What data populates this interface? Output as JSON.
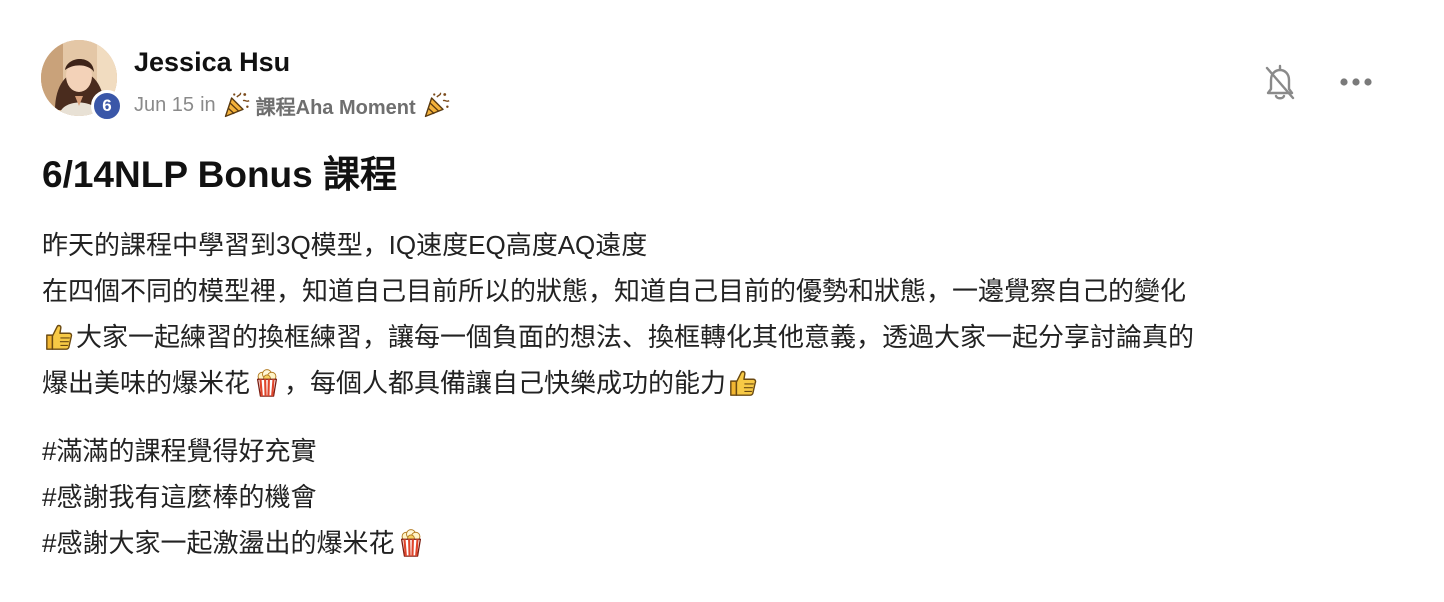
{
  "author": {
    "name": "Jessica Hsu",
    "level": "6"
  },
  "meta": {
    "date": "Jun 15",
    "in_word": "in",
    "category": "課程Aha Moment",
    "category_emoji": "party-popper"
  },
  "post": {
    "title": "6/14NLP Bonus 課程",
    "lines": {
      "l1": "昨天的課程中學習到3Q模型，IQ速度EQ高度AQ遠度",
      "l2": "在四個不同的模型裡，知道自己目前所以的狀態，知道自己目前的優勢和狀態，一邊覺察自己的變化",
      "l3": "大家一起練習的換框練習，讓每一個負面的想法、換框轉化其他意義，透過大家一起分享討論真的",
      "l4a": "爆出美味的爆米花",
      "l4b": "，每個人都具備讓自己快樂成功的能力"
    },
    "hashtags": {
      "h1": "#滿滿的課程覺得好充實",
      "h2": "#感謝我有這麼棒的機會",
      "h3": "#感謝大家一起激盪出的爆米花"
    }
  },
  "icons": {
    "bell": "bell-off-icon",
    "more": "more-horizontal-icon",
    "thumbs_up": "thumbs-up-emoji",
    "popcorn": "popcorn-emoji"
  },
  "colors": {
    "badge": "#3a57a8",
    "meta_text": "#8a8a8a",
    "emoji_yellow": "#f2b631",
    "popcorn_red": "#e0452b"
  }
}
